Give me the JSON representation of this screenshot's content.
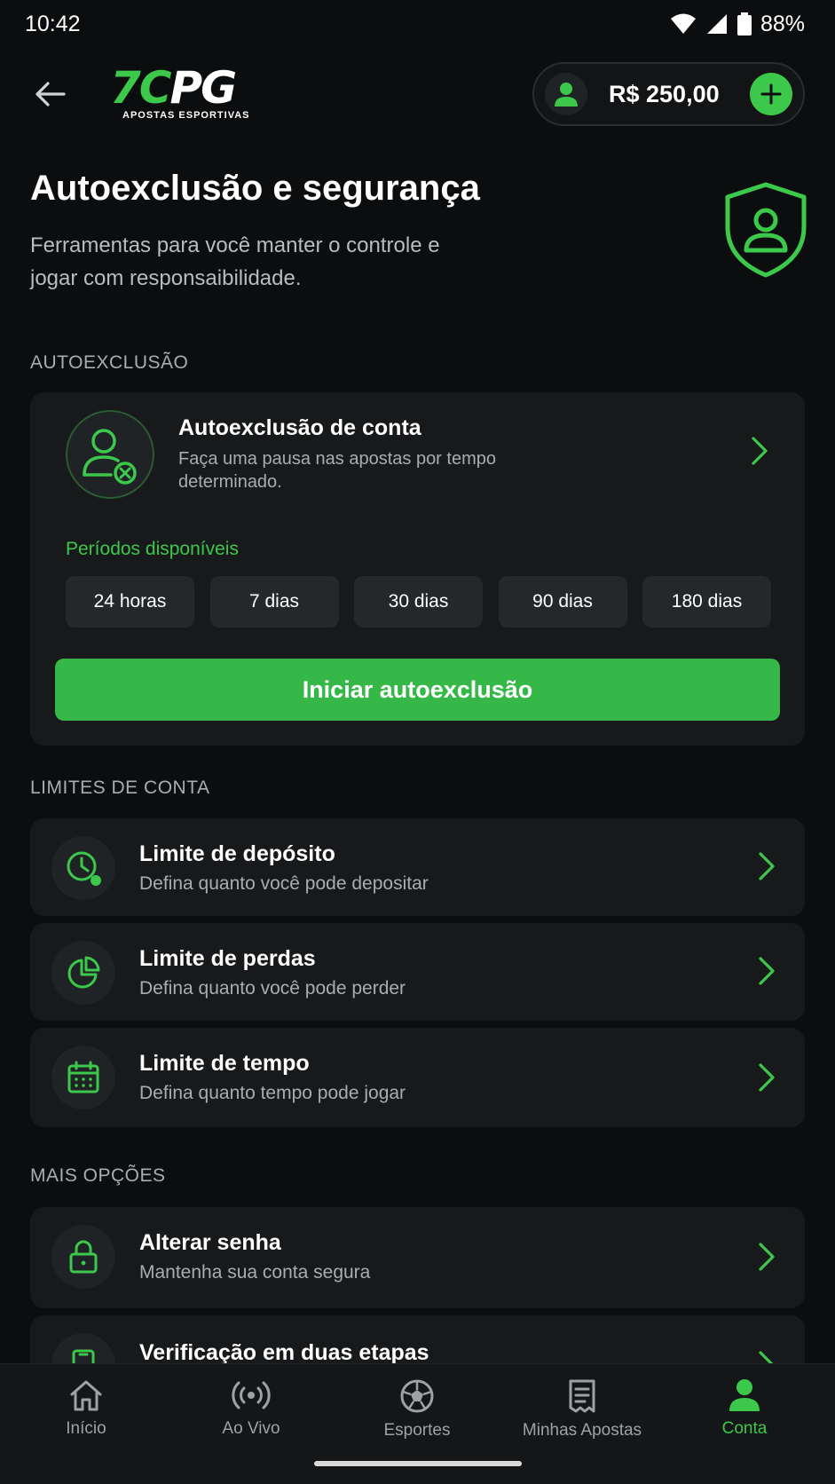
{
  "status_bar": {
    "time": "10:42",
    "battery": "88%"
  },
  "header": {
    "logo_text_green": "7C",
    "logo_text_white": "PG",
    "logo_subtitle": "APOSTAS ESPORTIVAS",
    "balance": "R$ 250,00"
  },
  "page": {
    "title": "Autoexclusão e segurança",
    "subtitle": "Ferramentas para você manter o controle e jogar com responsaibilidade."
  },
  "self_exclusion": {
    "section_label": "AUTOEXCLUSÃO",
    "card_title": "Autoexclusão de conta",
    "card_desc": "Faça uma pausa nas apostas por tempo determinado.",
    "periods_label": "Períodos disponíveis",
    "periods": [
      "24 horas",
      "7 dias",
      "30 dias",
      "90 dias",
      "180 dias"
    ],
    "button_label": "Iniciar autoexclusão"
  },
  "limits": {
    "section_label": "LIMITES DE CONTA",
    "items": [
      {
        "title": "Limite de depósito",
        "desc": "Defina quanto você pode depositar",
        "icon": "clock-dollar-icon"
      },
      {
        "title": "Limite de perdas",
        "desc": "Defina quanto você pode perder",
        "icon": "pie-chart-icon"
      },
      {
        "title": "Limite de tempo",
        "desc": "Defina quanto tempo pode jogar",
        "icon": "calendar-icon"
      }
    ]
  },
  "more": {
    "section_label": "MAIS OPÇÕES",
    "items": [
      {
        "title": "Alterar senha",
        "desc": "Mantenha sua conta segura",
        "icon": "lock-icon"
      },
      {
        "title": "Verificação em duas etapas",
        "desc": "",
        "icon": "phone-shield-icon"
      }
    ]
  },
  "bottom_nav": {
    "items": [
      {
        "label": "Início",
        "icon": "home-icon"
      },
      {
        "label": "Ao Vivo",
        "icon": "live-icon"
      },
      {
        "label": "Esportes",
        "icon": "soccer-ball-icon"
      },
      {
        "label": "Minhas Apostas",
        "icon": "betslip-icon"
      },
      {
        "label": "Conta",
        "icon": "user-icon"
      }
    ],
    "active": "Conta"
  },
  "colors": {
    "accent": "#3cc84a",
    "background": "#0c0d0e",
    "card": "#17191b"
  }
}
